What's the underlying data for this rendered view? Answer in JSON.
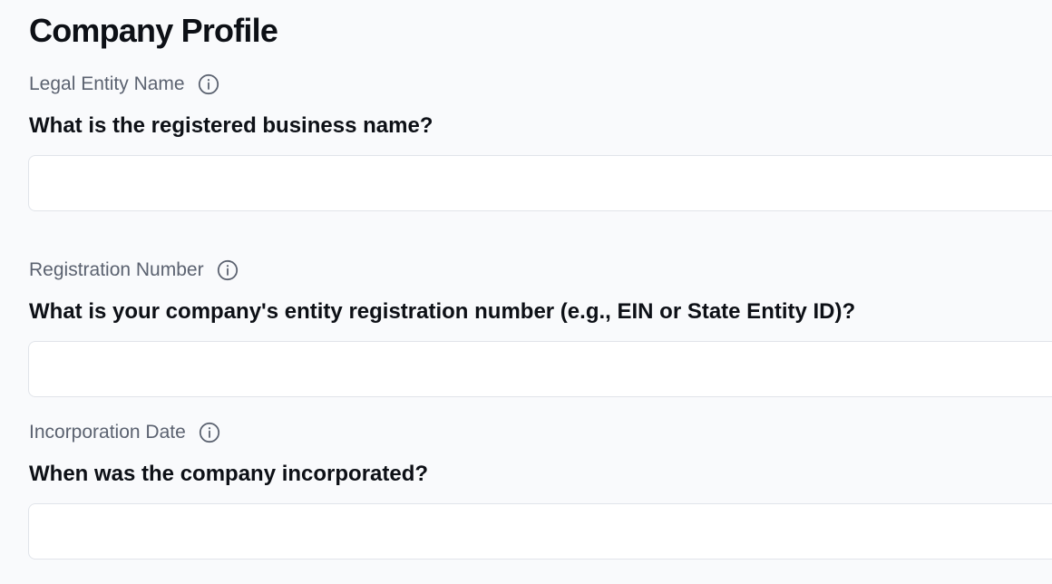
{
  "page": {
    "title": "Company Profile"
  },
  "fields": [
    {
      "label": "Legal Entity Name",
      "question": "What is the registered business name?",
      "value": "",
      "placeholder": "",
      "icon": "info-icon"
    },
    {
      "label": "Registration Number",
      "question": "What is your company's entity registration number (e.g., EIN or State Entity ID)?",
      "value": "",
      "placeholder": "",
      "icon": "info-icon"
    },
    {
      "label": "Incorporation Date",
      "question": "When was the company incorporated?",
      "value": "",
      "placeholder": "",
      "icon": "info-icon"
    }
  ],
  "colors": {
    "background": "#f9fafc",
    "label": "#5b6270",
    "heading": "#0d1016",
    "input_border": "#e1e4ea"
  }
}
